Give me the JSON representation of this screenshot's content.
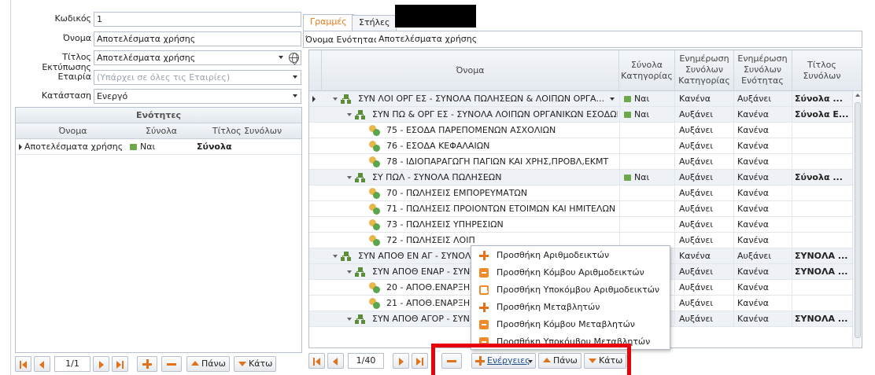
{
  "form": {
    "code_label": "Κωδικός",
    "code_value": "1",
    "name_label": "Όνομα",
    "name_value": "Αποτελέσματα χρήσης",
    "print_title_label": "Τίτλος Εκτύπωσης",
    "print_title_value": "Αποτελέσματα χρήσης",
    "company_label": "Εταιρία",
    "company_placeholder": "(Υπάρχει σε όλες τις Εταιρίες)",
    "status_label": "Κατάσταση",
    "status_value": "Ενεργό"
  },
  "sections_panel": {
    "title": "Ενότητες",
    "columns": [
      "Όνομα",
      "Σύνολα",
      "Τίτλος Συνόλων"
    ],
    "rows": [
      {
        "name": "Αποτελέσματα χρήσης",
        "totals": "Ναι",
        "totals_title": "Σύνολα"
      }
    ],
    "pager": "1/1",
    "up_label": "Πάνω",
    "down_label": "Κάτω"
  },
  "tabs": [
    "Γραμμές",
    "Στήλες"
  ],
  "section_name_label": "Όνομα Ενότητας",
  "section_name_value": "Αποτελέσματα χρήσης",
  "lines_grid": {
    "columns": [
      "Όνομα",
      "Σύνολα Κατηγορίας",
      "Ενημέρωση Συνόλων Κατηγορίας",
      "Ενημέρωση Συνόλων Ενότητας",
      "Τίτλος Συνόλων"
    ],
    "rows": [
      {
        "name": "ΣΥΝ ΛΟΙ ΟΡΓ ΕΣ - ΣΥΝΟΛΑ ΠΩΛΗΣΕΩΝ & ΛΟΙΠΩΝ ΟΡΓΑ...",
        "cat_totals": "Ναι",
        "upd_cat": "Κανένα",
        "upd_sec": "Αυξάνει",
        "title": "Σύνολα ..."
      },
      {
        "name": "ΣΥΝ ΠΩ & ΟΡΓ ΕΣ - ΣΥΝΟΛΑ ΛΟΙΠΩΝ ΟΡΓΑΝΙΚΩΝ ΕΣΟΔΩΝ",
        "cat_totals": "Ναι",
        "upd_cat": "Αυξάνει",
        "upd_sec": "Κανένα",
        "title": "Σύνολα Ε..."
      },
      {
        "name": "75 - ΕΣΟΔΑ ΠΑΡΕΠΟΜΕΝΩΝ ΑΣΧΟΛΙΩΝ",
        "cat_totals": "",
        "upd_cat": "Αυξάνει",
        "upd_sec": "Κανένα",
        "title": ""
      },
      {
        "name": "76 - ΕΣΟΔΑ ΚΕΦΑΛΑΙΩΝ",
        "cat_totals": "",
        "upd_cat": "Αυξάνει",
        "upd_sec": "Κανένα",
        "title": ""
      },
      {
        "name": "78 - ΙΔΙΟΠΑΡΑΓΩΓΗ ΠΑΓΙΩΝ ΚΑΙ ΧΡΗΣ,ΠΡΟΒΛ,ΕΚΜΤ",
        "cat_totals": "",
        "upd_cat": "Αυξάνει",
        "upd_sec": "Κανένα",
        "title": ""
      },
      {
        "name": "ΣΥ ΠΩΛ - ΣΥΝΟΛΑ ΠΩΛΗΣΕΩΝ",
        "cat_totals": "Ναι",
        "upd_cat": "Αυξάνει",
        "upd_sec": "Κανένα",
        "title": "Σύνολα ..."
      },
      {
        "name": "70 - ΠΩΛΗΣΕΙΣ ΕΜΠΟΡΕΥΜΑΤΩΝ",
        "cat_totals": "",
        "upd_cat": "Αυξάνει",
        "upd_sec": "Κανένα",
        "title": ""
      },
      {
        "name": "71 - ΠΩΛΗΣΕΙΣ ΠΡΟΙΟΝΤΩΝ ΕΤΟΙΜΩΝ ΚΑΙ ΗΜΙΤΕΛΩΝ",
        "cat_totals": "",
        "upd_cat": "Αυξάνει",
        "upd_sec": "Κανένα",
        "title": ""
      },
      {
        "name": "73 - ΠΩΛΗΣΕΙΣ ΥΠΗΡΕΣΙΩΝ",
        "cat_totals": "",
        "upd_cat": "Αυξάνει",
        "upd_sec": "Κανένα",
        "title": ""
      },
      {
        "name": "72 - ΠΩΛΗΣΕΙΣ ΛΟΙΠ",
        "cat_totals": "",
        "upd_cat": "Αυξάνει",
        "upd_sec": "Κανένα",
        "title": ""
      },
      {
        "name": "ΣΥΝ ΑΠΟΘ ΕΝ ΑΓ - ΣΥΝΟΛ",
        "cat_totals": "",
        "upd_cat": "Κανένα",
        "upd_sec": "Αυξάνει",
        "title": "ΣΥΝΟΛΑ ..."
      },
      {
        "name": "ΣΥΝ ΑΠΟΘ ΕΝΑΡ - ΣΥΝΟ",
        "cat_totals": "",
        "upd_cat": "Αυξάνει",
        "upd_sec": "Κανένα",
        "title": "ΣΥΝΟΛΑ ..."
      },
      {
        "name": "20 - ΑΠΟΘ.ΕΝΑΡΞΗΣ",
        "cat_totals": "",
        "upd_cat": "Αυξάνει",
        "upd_sec": "Κανένα",
        "title": ""
      },
      {
        "name": "21 - ΑΠΟΘ.ΕΝΑΡΞΗΣ",
        "cat_totals": "",
        "upd_cat": "Αυξάνει",
        "upd_sec": "Κανένα",
        "title": ""
      },
      {
        "name": "ΣΥΝ ΑΠΟΘ ΑΓΟΡ - ΣΥΝ",
        "cat_totals": "",
        "upd_cat": "Αυξάνει",
        "upd_sec": "Κανένα",
        "title": "ΣΥΝΟΛΑ ..."
      }
    ],
    "pager": "1/40",
    "actions_label": "Ενέργειες",
    "up_label": "Πάνω",
    "down_label": "Κάτω"
  },
  "actions_menu": {
    "items": [
      "Προσθήκη Αριθμοδεικτών",
      "Προσθήκη Κόμβου Αριθμοδεικτών",
      "Προσθήκη Υποκόμβου Αριθμοδεικτών",
      "Προσθήκη Μεταβλητών",
      "Προσθήκη Κόμβου Μεταβλητών",
      "Προσθήκη Υποκόμβου Μεταβλητών"
    ]
  },
  "colors": {
    "accent": "#e0731b",
    "highlight_box": "#e8000b",
    "header_bg": "#e4e9ef",
    "node_row_bg": "#eef1f5"
  }
}
